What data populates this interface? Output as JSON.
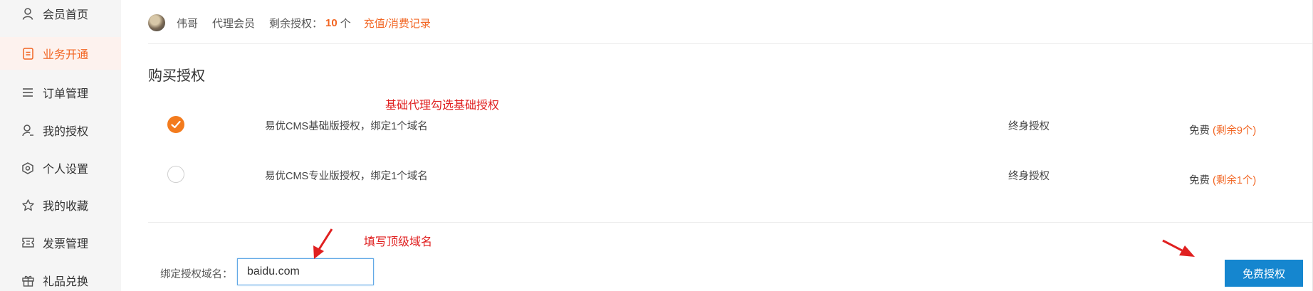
{
  "sidebar": {
    "items": [
      {
        "label": "会员首页",
        "icon": "user-icon",
        "active": false
      },
      {
        "label": "业务开通",
        "icon": "document-icon",
        "active": true
      },
      {
        "label": "订单管理",
        "icon": "list-icon",
        "active": false
      },
      {
        "label": "我的授权",
        "icon": "user-key-icon",
        "active": false
      },
      {
        "label": "个人设置",
        "icon": "settings-icon",
        "active": false
      },
      {
        "label": "我的收藏",
        "icon": "star-icon",
        "active": false
      },
      {
        "label": "发票管理",
        "icon": "ticket-icon",
        "active": false
      },
      {
        "label": "礼品兑换",
        "icon": "gift-icon",
        "active": false
      }
    ]
  },
  "member": {
    "name": "伟哥",
    "level": "代理会员",
    "remaining_label": "剩余授权：",
    "remaining_count": "10",
    "remaining_unit": "个",
    "record_link": "充值/消费记录"
  },
  "purchase": {
    "title": "购买授权",
    "licenses": [
      {
        "name": "易优CMS基础版授权，绑定1个域名",
        "term": "终身授权",
        "price": "免费",
        "remaining": "(剩余9个)",
        "selected": true
      },
      {
        "name": "易优CMS专业版授权，绑定1个域名",
        "term": "终身授权",
        "price": "免费",
        "remaining": "(剩余1个)",
        "selected": false
      }
    ]
  },
  "annotations": {
    "basic_hint": "基础代理勾选基础授权",
    "domain_hint": "填写顶级域名"
  },
  "bind": {
    "label": "绑定授权域名：",
    "domain_value": "baidu.com"
  },
  "actions": {
    "free_license_button": "免费授权"
  },
  "colors": {
    "accent": "#f26522",
    "checkbox": "#f37b1d",
    "button": "#1586cf",
    "annotation": "#e02020",
    "input_border": "#63a9e6"
  }
}
